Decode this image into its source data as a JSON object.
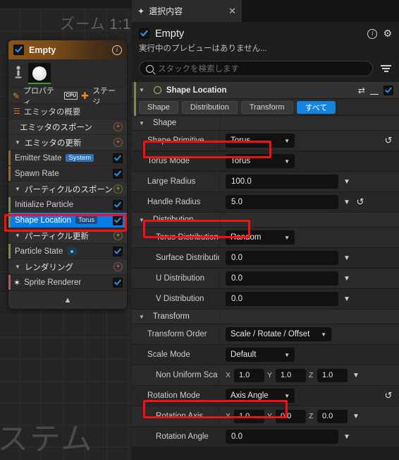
{
  "viewport": {
    "zoom_label": "ズーム",
    "zoom_ratio": "1:1",
    "ghost_text": "ステム"
  },
  "emitter_panel": {
    "header": {
      "name": "Empty",
      "checkbox_checked": true,
      "info_icon": "info-icon"
    },
    "toolbar": {
      "properties_label": "プロパティ",
      "cpu_badge": "CPU",
      "stage_label": "ステージ"
    },
    "summary_label": "エミッタの概要",
    "sections": [
      {
        "label": "エミッタのスポーン",
        "type": "section",
        "expanded": false,
        "plus_color": "#c4744a"
      },
      {
        "label": "エミッタの更新",
        "type": "section",
        "expanded": true,
        "plus_color": "#c4744a"
      },
      {
        "label": "Emitter State",
        "type": "item",
        "pill": "System",
        "checked": true,
        "accent": "#8a6a3a"
      },
      {
        "label": "Spawn Rate",
        "type": "item",
        "pill": "",
        "checked": true,
        "accent": "#8a6a3a"
      },
      {
        "label": "パーティクルのスポーン",
        "type": "section",
        "expanded": true,
        "plus_color": "#93a84e"
      },
      {
        "label": "Initialize Particle",
        "type": "item",
        "pill": "",
        "checked": true,
        "accent": "#7b8a52"
      },
      {
        "label": "Shape Location",
        "type": "item",
        "pill": "Torus",
        "checked": true,
        "accent": "#7b8a52",
        "selected": true
      },
      {
        "label": "パーティクル更新",
        "type": "section",
        "expanded": true,
        "plus_color": "#93a84e"
      },
      {
        "label": "Particle State",
        "type": "item",
        "pill": "dot",
        "checked": true,
        "accent": "#7b8a52"
      },
      {
        "label": "レンダリング",
        "type": "section",
        "expanded": true,
        "plus_color": "#c06a80"
      },
      {
        "label": "Sprite Renderer",
        "type": "item",
        "pill": "",
        "checked": true,
        "accent": "#b05a68",
        "icon": "burst-icon"
      }
    ],
    "collapse_icon": "chevron-up-icon"
  },
  "selection_panel": {
    "tab": {
      "title": "選択内容",
      "icon": "sparkle-icon",
      "close_icon": "close-icon"
    },
    "header": {
      "title": "Empty",
      "checkbox_checked": true,
      "subtitle": "実行中のプレビューはありません...",
      "info_icon": "info-icon",
      "gear_icon": "gear-icon"
    },
    "search": {
      "placeholder": "スタックを検索します",
      "value": "",
      "search_icon": "search-icon",
      "filter_icon": "filter-icon"
    },
    "module": {
      "name": "Shape Location",
      "expanded": true,
      "shuffle_icon": "shuffle-icon",
      "trash_icon": "trash-icon",
      "enabled_checkbox": true,
      "tabs": [
        {
          "label": "Shape",
          "active": false
        },
        {
          "label": "Distribution",
          "active": false
        },
        {
          "label": "Transform",
          "active": false
        },
        {
          "label": "すべて",
          "active": true
        }
      ]
    },
    "groups": [
      {
        "label": "Shape",
        "rows": [
          {
            "name": "Shape Primitive",
            "control": "dropdown",
            "value": "Torus",
            "reset": true,
            "highlight": true
          },
          {
            "name": "Torus Mode",
            "control": "dropdown",
            "value": "Torus",
            "reset": false
          },
          {
            "name": "Large Radius",
            "control": "field",
            "value": "100.0",
            "chevron": true
          },
          {
            "name": "Handle Radius",
            "control": "field",
            "value": "5.0",
            "chevron": true,
            "reset": true,
            "highlight": true
          }
        ]
      },
      {
        "label": "Distribution",
        "rows": [
          {
            "name": "Torus Distribution M",
            "control": "dropdown",
            "value": "Random"
          },
          {
            "name": "Surface Distribution",
            "control": "field",
            "value": "0.0",
            "chevron": true
          },
          {
            "name": "U Distribution",
            "control": "field",
            "value": "0.0",
            "chevron": true
          },
          {
            "name": "V Distribution",
            "control": "field",
            "value": "0.0",
            "chevron": true
          }
        ]
      },
      {
        "label": "Transform",
        "rows": [
          {
            "name": "Transform Order",
            "control": "dropdown-wide",
            "value": "Scale / Rotate / Offset"
          },
          {
            "name": "Scale Mode",
            "control": "dropdown",
            "value": "Default"
          },
          {
            "name": "Non Uniform Sca",
            "control": "vector",
            "deep": true,
            "axes": [
              "X",
              "Y",
              "Z"
            ],
            "values": [
              "1.0",
              "1.0",
              "1.0"
            ],
            "chevron": true
          },
          {
            "name": "Rotation Mode",
            "control": "dropdown",
            "value": "Axis Angle",
            "reset": true,
            "highlight": true
          },
          {
            "name": "Rotation Axis",
            "control": "vector",
            "deep": true,
            "axes": [
              "X",
              "Y",
              "Z"
            ],
            "values": [
              "1.0",
              "0.0",
              "0.0"
            ],
            "chevron": true
          },
          {
            "name": "Rotation Angle",
            "control": "field",
            "deep": true,
            "value": "0.0",
            "chevron": true
          }
        ]
      }
    ]
  },
  "annotations": {
    "color": "#f81010",
    "boxes": [
      {
        "name": "shape-location-row-highlight"
      },
      {
        "name": "shape-primitive-highlight"
      },
      {
        "name": "handle-radius-highlight"
      },
      {
        "name": "rotation-mode-highlight"
      }
    ]
  }
}
